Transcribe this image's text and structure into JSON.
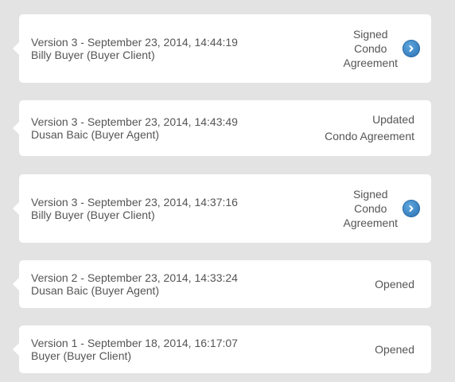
{
  "history": [
    {
      "version_line": "Version 3 - September 23, 2014, 14:44:19",
      "user_line": "Billy Buyer (Buyer Client)",
      "status_lines": [
        "Signed",
        "Condo",
        "Agreement"
      ],
      "has_arrow": true
    },
    {
      "version_line": "Version 3 - September 23, 2014, 14:43:49",
      "user_line": "Dusan Baic (Buyer Agent)",
      "status_lines": [
        "Updated",
        "Condo Agreement"
      ],
      "has_arrow": false
    },
    {
      "version_line": "Version 3 - September 23, 2014, 14:37:16",
      "user_line": "Billy Buyer (Buyer Client)",
      "status_lines": [
        "Signed",
        "Condo",
        "Agreement"
      ],
      "has_arrow": true
    },
    {
      "version_line": "Version 2 - September 23, 2014, 14:33:24",
      "user_line": "Dusan Baic (Buyer Agent)",
      "status_lines": [
        "Opened"
      ],
      "has_arrow": false
    },
    {
      "version_line": "Version 1 - September 18, 2014, 16:17:07",
      "user_line": "Buyer (Buyer Client)",
      "status_lines": [
        "Opened"
      ],
      "has_arrow": false
    }
  ],
  "icons": {
    "arrow": "chevron-right-icon"
  },
  "colors": {
    "background": "#e3e3e3",
    "card": "#ffffff",
    "text": "#555555",
    "accent": "#3f86c6"
  }
}
